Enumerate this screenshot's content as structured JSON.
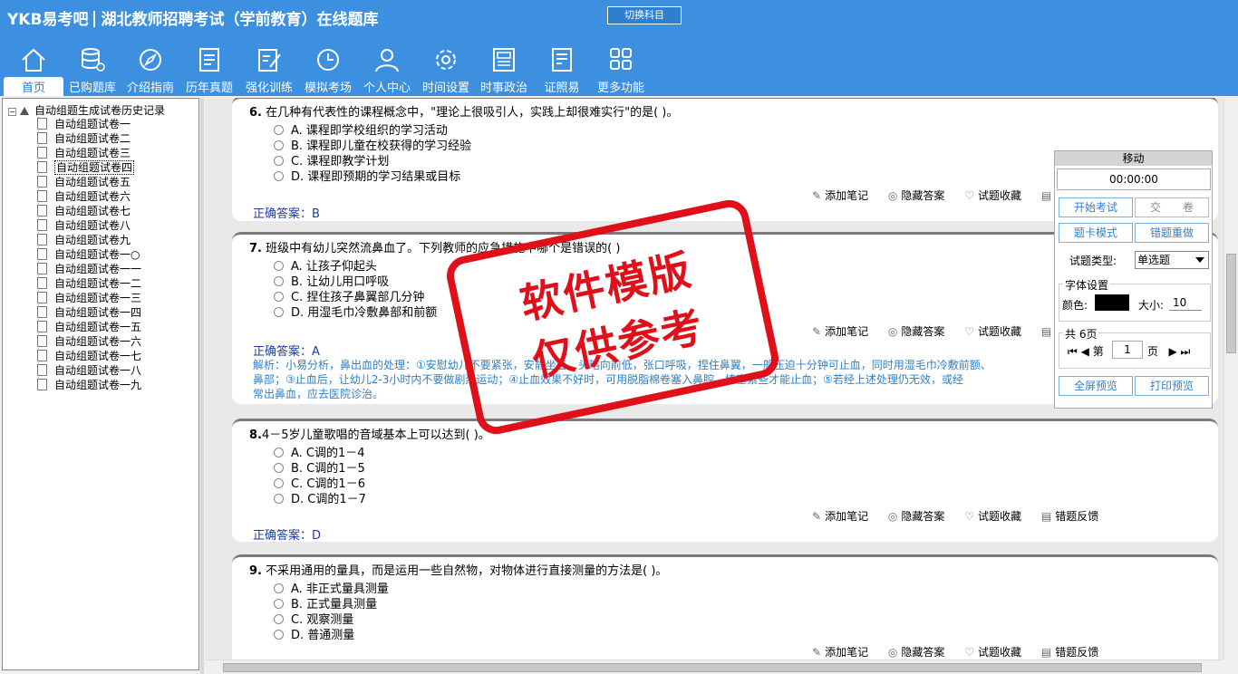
{
  "header": {
    "logo": "YKB易考吧",
    "title": "湖北教师招聘考试（学前教育）在线题库",
    "switch_label": "切换科目"
  },
  "nav": [
    {
      "label": "首页",
      "icon": "home-icon"
    },
    {
      "label": "已购题库",
      "icon": "database-icon"
    },
    {
      "label": "介绍指南",
      "icon": "compass-icon"
    },
    {
      "label": "历年真题",
      "icon": "list-icon"
    },
    {
      "label": "强化训练",
      "icon": "edit-icon"
    },
    {
      "label": "模拟考场",
      "icon": "clock-icon"
    },
    {
      "label": "个人中心",
      "icon": "user-icon"
    },
    {
      "label": "时间设置",
      "icon": "gear-icon"
    },
    {
      "label": "时事政治",
      "icon": "news-icon"
    },
    {
      "label": "证照易",
      "icon": "certificate-icon"
    },
    {
      "label": "更多功能",
      "icon": "grid-icon"
    }
  ],
  "sidebar": {
    "root": "自动组题生成试卷历史记录",
    "items": [
      "自动组题试卷一",
      "自动组题试卷二",
      "自动组题试卷三",
      "自动组题试卷四",
      "自动组题试卷五",
      "自动组题试卷六",
      "自动组题试卷七",
      "自动组题试卷八",
      "自动组题试卷九",
      "自动组题试卷一○",
      "自动组题试卷一一",
      "自动组题试卷一二",
      "自动组题试卷一三",
      "自动组题试卷一四",
      "自动组题试卷一五",
      "自动组题试卷一六",
      "自动组题试卷一七",
      "自动组题试卷一八",
      "自动组题试卷一九"
    ]
  },
  "tools": {
    "note": "添加笔记",
    "hide": "隐藏答案",
    "fav": "试题收藏",
    "feedback": "错题反馈"
  },
  "answer_prefix": "正确答案：",
  "questions": [
    {
      "num": "6.",
      "title": "在几种有代表性的课程概念中，\"理论上很吸引人，实践上却很难实行\"的是( )。",
      "options": [
        "A. 课程即学校组织的学习活动",
        "B. 课程即儿童在校获得的学习经验",
        "C. 课程即教学计划",
        "D. 课程即预期的学习结果或目标"
      ],
      "answer": "B"
    },
    {
      "num": "7.",
      "title": "班级中有幼儿突然流鼻血了。下列教师的应急措施中哪个是错误的( )",
      "options": [
        "A. 让孩子仰起头",
        "B. 让幼儿用口呼吸",
        "C. 捏住孩子鼻翼部几分钟",
        "D. 用湿毛巾冷敷鼻部和前额"
      ],
      "answer": "A",
      "analysis_line1": "解析：小易分析，鼻出血的处理：①安慰幼儿不要紧张，安静坐着，头略向前低，张口呼吸，捏住鼻翼，一般压迫十分钟可止血，同时用湿毛巾冷敷前额、",
      "analysis_line2": "鼻部；③止血后，让幼儿2-3小时内不要做剧烈运动；④止血效果不好时，可用脱脂棉卷塞入鼻腔，填塞紧些才能止血；⑤若经上述处理仍无效，或经",
      "analysis_line3": "常出鼻血，应去医院诊治。"
    },
    {
      "num": "8.",
      "title": "4－5岁儿童歌唱的音域基本上可以达到( )。",
      "options": [
        "A. C调的1－4",
        "B. C调的1－5",
        "C. C调的1－6",
        "D. C调的1－7"
      ],
      "answer": "D"
    },
    {
      "num": "9.",
      "title": "不采用通用的量具，而是运用一些自然物，对物体进行直接测量的方法是( )。",
      "options": [
        "A. 非正式量具测量",
        "B. 正式量具测量",
        "C. 观察测量",
        "D. 普通测量"
      ]
    }
  ],
  "panel": {
    "title": "移动",
    "timer": "00:00:00",
    "start": "开始考试",
    "submit": "交　　卷",
    "card_mode": "题卡模式",
    "redo": "错题重做",
    "type_label": "试题类型:",
    "type_value": "单选题",
    "font_group": "字体设置",
    "color_label": "颜色:",
    "size_label": "大小:",
    "size_value": "10",
    "pages_label": "共 6页",
    "page_prefix": "第",
    "page_value": "1",
    "page_suffix": "页",
    "fullscreen": "全屏预览",
    "print": "打印预览"
  },
  "watermark": {
    "line1": "软件模版",
    "line2": "仅供参考"
  }
}
